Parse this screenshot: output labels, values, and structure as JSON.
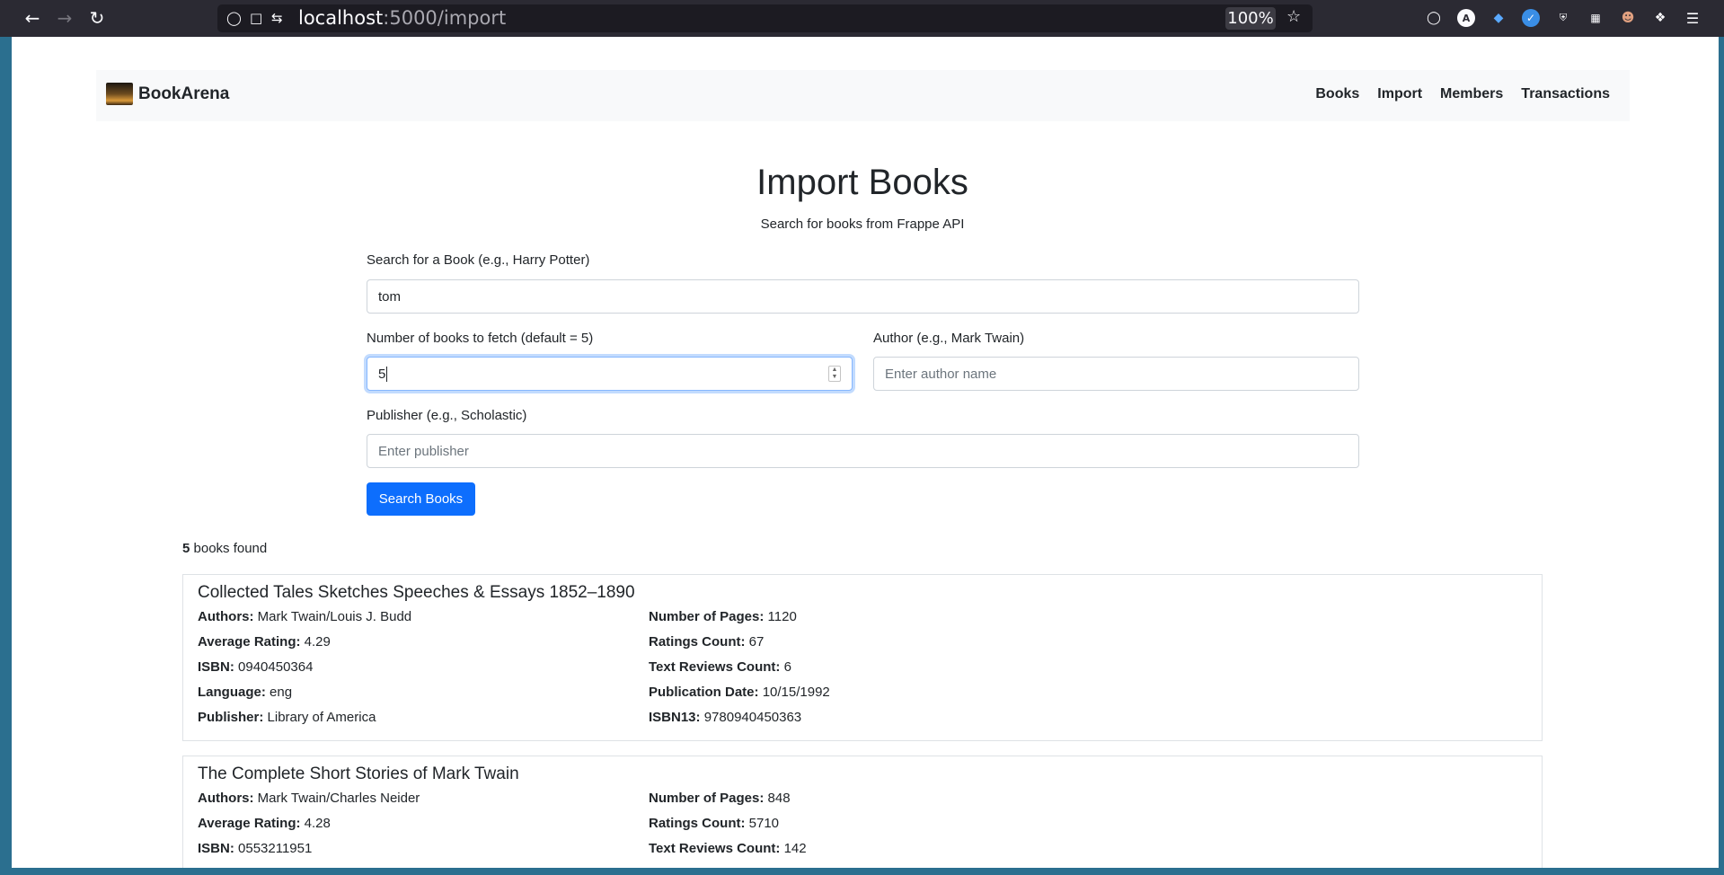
{
  "browser": {
    "url_host": "localhost",
    "url_path": ":5000/import",
    "zoom": "100%"
  },
  "navbar": {
    "brand": "BookArena",
    "links": [
      "Books",
      "Import",
      "Members",
      "Transactions"
    ]
  },
  "page": {
    "title": "Import Books",
    "subtitle": "Search for books from Frappe API"
  },
  "form": {
    "search_label": "Search for a Book (e.g., Harry Potter)",
    "search_value": "tom",
    "count_label": "Number of books to fetch (default = 5)",
    "count_value": "5",
    "author_label": "Author (e.g., Mark Twain)",
    "author_placeholder": "Enter author name",
    "publisher_label": "Publisher (e.g., Scholastic)",
    "publisher_placeholder": "Enter publisher",
    "submit_label": "Search Books"
  },
  "results": {
    "count": "5",
    "count_suffix": "books found",
    "books": [
      {
        "title": "Collected Tales Sketches Speeches & Essays 1852–1890",
        "authors": "Mark Twain/Louis J. Budd",
        "average_rating": "4.29",
        "isbn": "0940450364",
        "language": "eng",
        "publisher": "Library of America",
        "num_pages": "1120",
        "ratings_count": "67",
        "text_reviews_count": "6",
        "publication_date": "10/15/1992",
        "isbn13": "9780940450363"
      },
      {
        "title": "The Complete Short Stories of Mark Twain",
        "authors": "Mark Twain/Charles Neider",
        "average_rating": "4.28",
        "isbn": "0553211951",
        "num_pages": "848",
        "ratings_count": "5710",
        "text_reviews_count": "142"
      }
    ],
    "field_labels": {
      "authors": "Authors:",
      "average_rating": "Average Rating:",
      "isbn": "ISBN:",
      "language": "Language:",
      "publisher": "Publisher:",
      "num_pages": "Number of Pages:",
      "ratings_count": "Ratings Count:",
      "text_reviews_count": "Text Reviews Count:",
      "publication_date": "Publication Date:",
      "isbn13": "ISBN13:"
    }
  }
}
